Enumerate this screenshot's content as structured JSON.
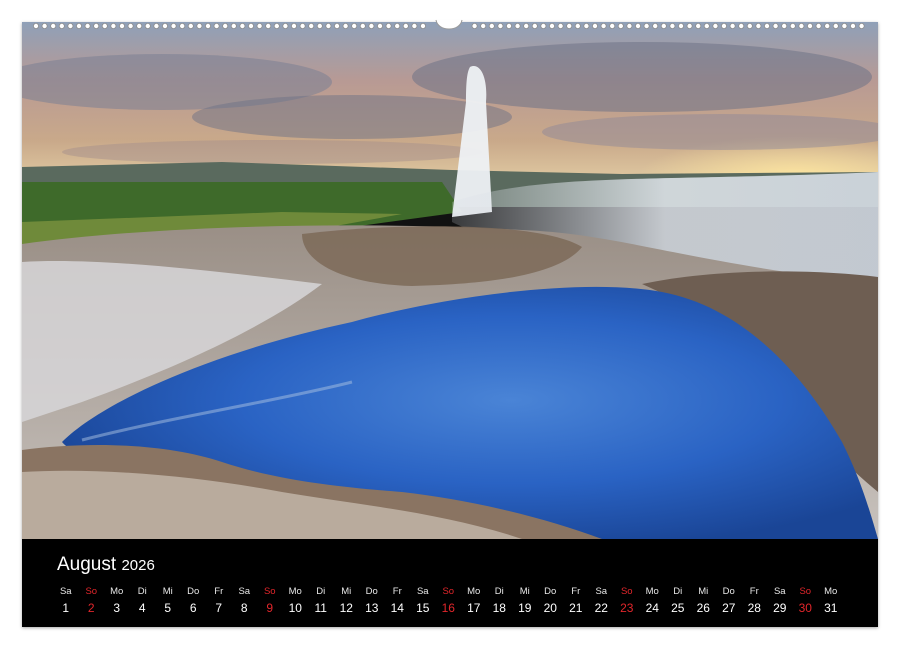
{
  "calendar": {
    "month": "August",
    "year": "2026",
    "weekend_color": "#e2262b",
    "days": [
      {
        "name": "Sa",
        "num": "1"
      },
      {
        "name": "So",
        "num": "2"
      },
      {
        "name": "Mo",
        "num": "3"
      },
      {
        "name": "Di",
        "num": "4"
      },
      {
        "name": "Mi",
        "num": "5"
      },
      {
        "name": "Do",
        "num": "6"
      },
      {
        "name": "Fr",
        "num": "7"
      },
      {
        "name": "Sa",
        "num": "8"
      },
      {
        "name": "So",
        "num": "9"
      },
      {
        "name": "Mo",
        "num": "10"
      },
      {
        "name": "Di",
        "num": "11"
      },
      {
        "name": "Mi",
        "num": "12"
      },
      {
        "name": "Do",
        "num": "13"
      },
      {
        "name": "Fr",
        "num": "14"
      },
      {
        "name": "Sa",
        "num": "15"
      },
      {
        "name": "So",
        "num": "16"
      },
      {
        "name": "Mo",
        "num": "17"
      },
      {
        "name": "Di",
        "num": "18"
      },
      {
        "name": "Mi",
        "num": "19"
      },
      {
        "name": "Do",
        "num": "20"
      },
      {
        "name": "Fr",
        "num": "21"
      },
      {
        "name": "Sa",
        "num": "22"
      },
      {
        "name": "So",
        "num": "23"
      },
      {
        "name": "Mo",
        "num": "24"
      },
      {
        "name": "Di",
        "num": "25"
      },
      {
        "name": "Mi",
        "num": "26"
      },
      {
        "name": "Do",
        "num": "27"
      },
      {
        "name": "Fr",
        "num": "28"
      },
      {
        "name": "Sa",
        "num": "29"
      },
      {
        "name": "So",
        "num": "30"
      },
      {
        "name": "Mo",
        "num": "31"
      }
    ]
  }
}
